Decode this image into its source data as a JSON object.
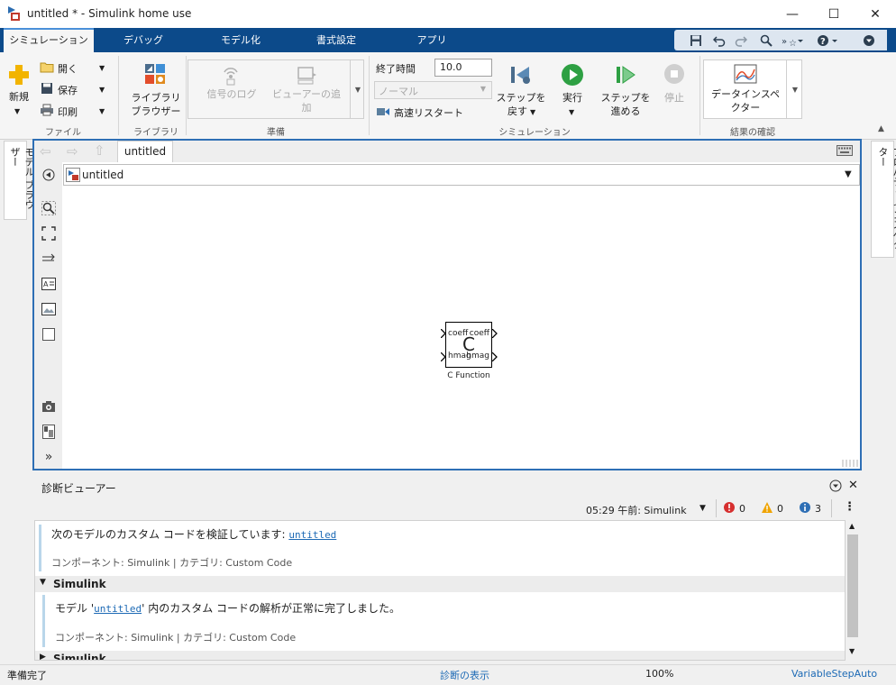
{
  "window": {
    "title": "untitled * - Simulink home use",
    "minimize_glyph": "—",
    "maximize_glyph": "☐",
    "close_glyph": "✕"
  },
  "ribbon_tabs": [
    {
      "label": "シミュレーション",
      "active": true
    },
    {
      "label": "デバッグ",
      "active": false
    },
    {
      "label": "モデル化",
      "active": false
    },
    {
      "label": "書式設定",
      "active": false
    },
    {
      "label": "アプリ",
      "active": false
    }
  ],
  "quick_access": [
    "save-icon",
    "undo-icon",
    "redo-icon",
    "search-icon",
    "shortcut-icon",
    "help-icon",
    "collapse-icon"
  ],
  "ribbon": {
    "file": {
      "title": "ファイル",
      "new_label": "新規",
      "open_label": "開く",
      "save_label": "保存",
      "print_label": "印刷"
    },
    "library": {
      "title": "ライブラリ",
      "browser_label_1": "ライブラリ",
      "browser_label_2": "ブラウザー"
    },
    "prepare": {
      "title": "準備",
      "signal_log_label": "信号のログ",
      "add_viewer_label_1": "ビューアーの追",
      "add_viewer_label_2": "加"
    },
    "simulation": {
      "title": "シミュレーション",
      "stop_time_label": "終了時間",
      "stop_time_value": "10.0",
      "mode_value": "ノーマル",
      "fast_restart_label": "高速リスタート",
      "step_back_label_1": "ステップを",
      "step_back_label_2": "戻す",
      "run_label": "実行",
      "step_forward_label_1": "ステップを",
      "step_forward_label_2": "進める",
      "stop_label": "停止"
    },
    "review": {
      "title": "結果の確認",
      "data_inspector_label_1": "データインスペ",
      "data_inspector_label_2": "クター"
    }
  },
  "sidebars": {
    "left_label": "モデル ブラウザー",
    "right_label": "プロパティ インスペクター"
  },
  "editor": {
    "tab_label": "untitled",
    "address_label": "untitled"
  },
  "block": {
    "glyph": "C",
    "in_port_1": "coeff",
    "out_port_1": "coeff",
    "in_port_2": "hmag",
    "out_port_2": "hmag",
    "name": "C Function"
  },
  "diagnostics": {
    "title": "診断ビューアー",
    "timestamp": "05:29 午前: Simulink",
    "error_count": "0",
    "warning_count": "0",
    "info_count": "3",
    "messages": [
      {
        "text": "次のモデルのカスタム コードを検証しています: ",
        "link": "untitled",
        "meta": "コンポーネント: Simulink | カテゴリ: Custom Code"
      }
    ],
    "group_label": "Simulink",
    "group_message": {
      "prefix": "モデル '",
      "link": "untitled",
      "suffix": "' 内のカスタム コードの解析が正常に完了しました。",
      "meta": "コンポーネント: Simulink | カテゴリ: Custom Code"
    },
    "group_label_2": "Simulink"
  },
  "status": {
    "ready": "準備完了",
    "show_diagnostics": "診断の表示",
    "zoom": "100%",
    "solver": "VariableStepAuto"
  },
  "colors": {
    "tabstrip": "#0c4a8a",
    "editor_border": "#2e6fb5",
    "run_green": "#2ea043",
    "link_blue": "#1d6ab5"
  }
}
